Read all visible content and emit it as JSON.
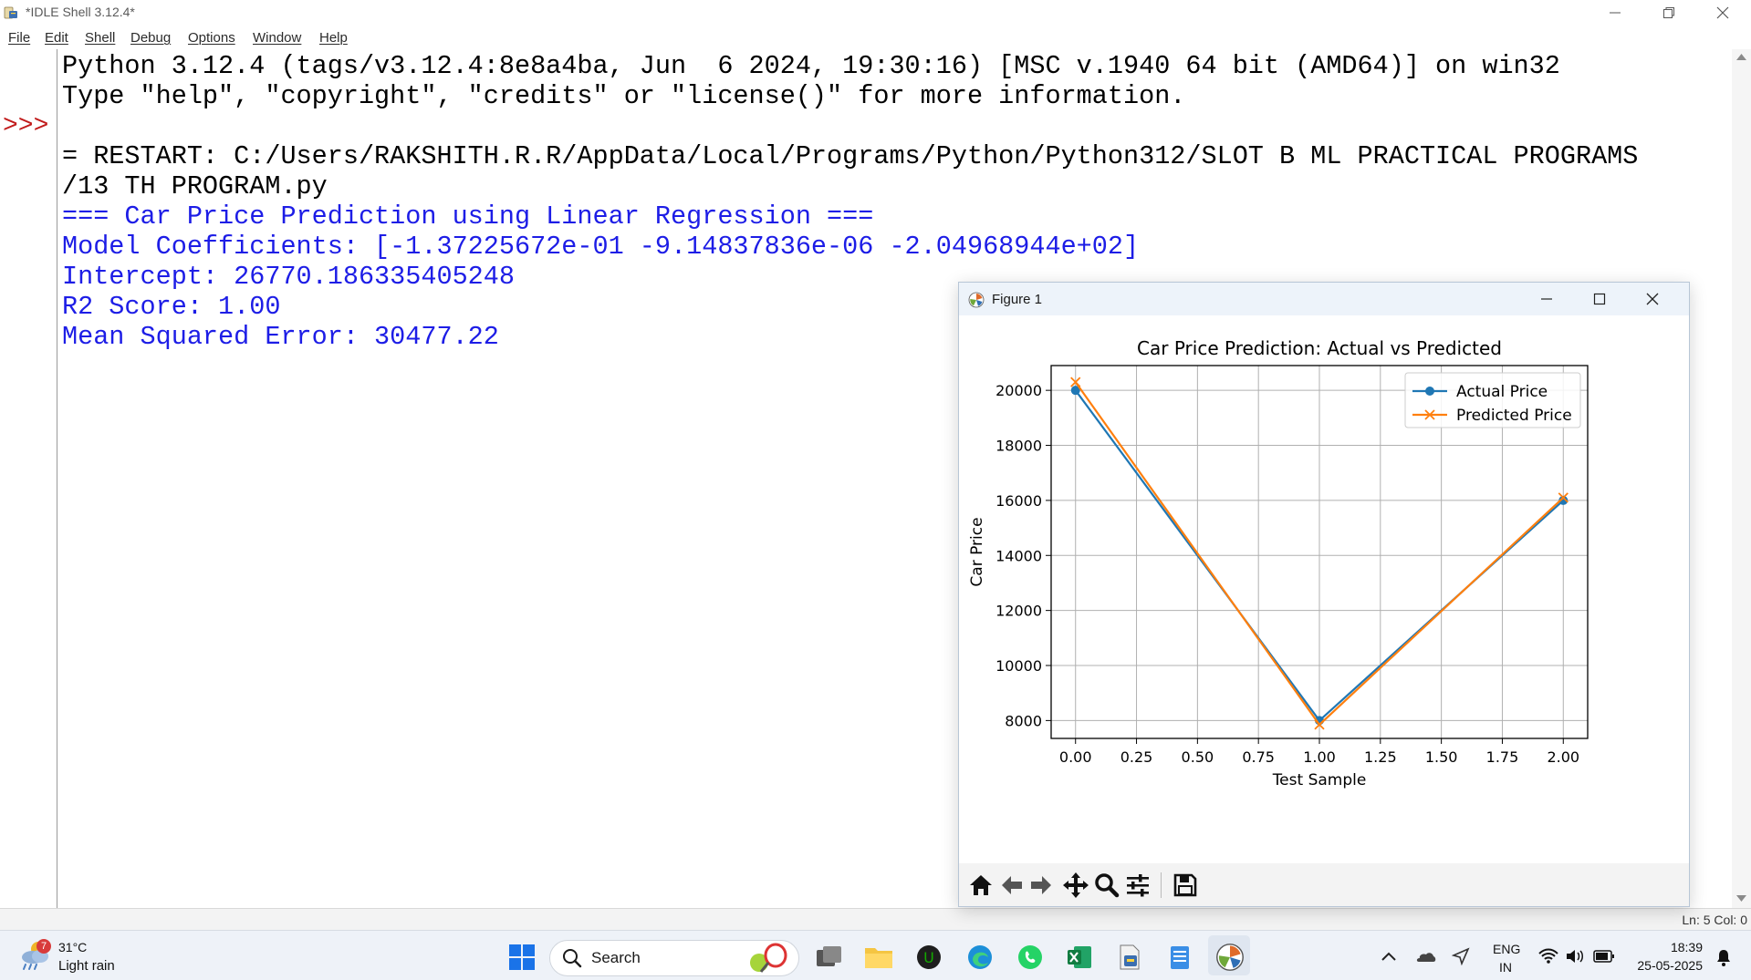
{
  "idle": {
    "title": "*IDLE Shell 3.12.4*",
    "menu": [
      "File",
      "Edit",
      "Shell",
      "Debug",
      "Options",
      "Window",
      "Help"
    ],
    "prompt": ">>>",
    "lines": [
      "Python 3.12.4 (tags/v3.12.4:8e8a4ba, Jun  6 2024, 19:30:16) [MSC v.1940 64 bit (AMD64)] on win32",
      "Type \"help\", \"copyright\", \"credits\" or \"license()\" for more information.",
      "= RESTART: C:/Users/RAKSHITH.R.R/AppData/Local/Programs/Python/Python312/SLOT B ML PRACTICAL PROGRAMS",
      "/13 TH PROGRAM.py",
      "=== Car Price Prediction using Linear Regression ===",
      "Model Coefficients: [-1.37225672e-01 -9.14837836e-06 -2.04968944e+02]",
      "Intercept: 26770.186335405248",
      "R2 Score: 1.00",
      "Mean Squared Error: 30477.22"
    ],
    "status": "Ln: 5   Col: 0"
  },
  "figure": {
    "title": "Figure 1",
    "toolbar": [
      "home-icon",
      "back-arrow-icon",
      "forward-arrow-icon",
      "pan-icon",
      "zoom-icon",
      "configure-icon",
      "save-icon"
    ]
  },
  "chart_data": {
    "type": "line",
    "title": "Car Price Prediction: Actual vs Predicted",
    "xlabel": "Test Sample",
    "ylabel": "Car Price",
    "xlim": [
      -0.1,
      2.1
    ],
    "ylim": [
      7350,
      20900
    ],
    "x_ticks": [
      "0.00",
      "0.25",
      "0.50",
      "0.75",
      "1.00",
      "1.25",
      "1.50",
      "1.75",
      "2.00"
    ],
    "y_ticks": [
      "8000",
      "10000",
      "12000",
      "14000",
      "16000",
      "18000",
      "20000"
    ],
    "x": [
      0,
      1,
      2
    ],
    "grid": true,
    "legend_position": "top-right",
    "series": [
      {
        "name": "Actual Price",
        "values": [
          20000,
          8000,
          16000
        ],
        "color": "#1f77b4",
        "marker": "o"
      },
      {
        "name": "Predicted Price",
        "values": [
          20300,
          7850,
          16100
        ],
        "color": "#ff7f0e",
        "marker": "x"
      }
    ]
  },
  "taskbar": {
    "weather_badge": "7",
    "weather_temp": "31°C",
    "weather_desc": "Light rain",
    "search_label": "Search",
    "lang1": "ENG",
    "lang2": "IN",
    "time": "18:39",
    "date": "25-05-2025"
  }
}
